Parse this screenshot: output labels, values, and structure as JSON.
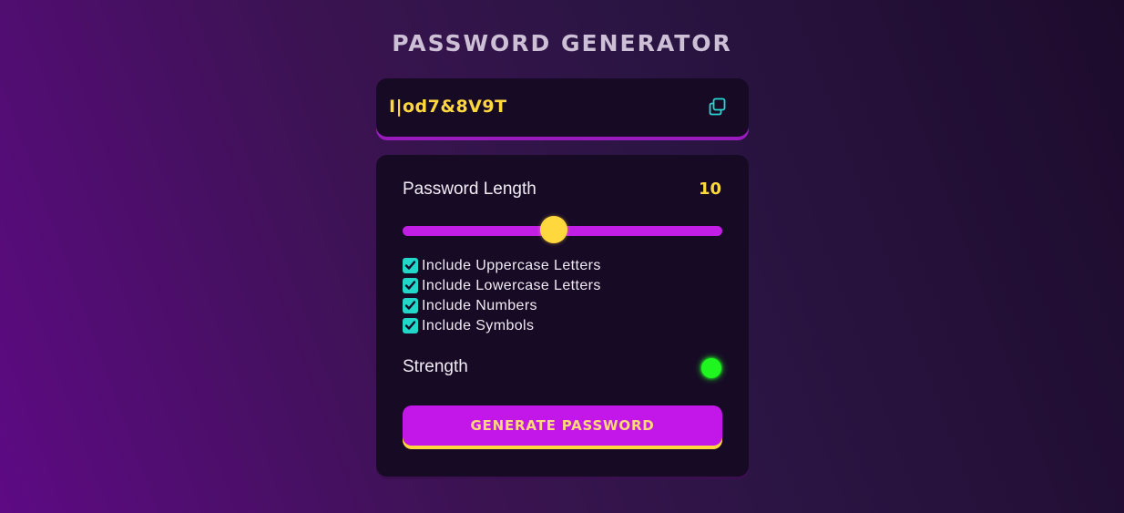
{
  "app": {
    "title": "PASSWORD GENERATOR"
  },
  "result": {
    "password": "I|od7&8V9T",
    "copy_icon": "copy-icon"
  },
  "settings": {
    "length_label": "Password Length",
    "length_value": "10",
    "slider": {
      "value": 10,
      "fraction": 0.47
    },
    "options": [
      {
        "label": "Include Uppercase Letters",
        "checked": true
      },
      {
        "label": "Include Lowercase Letters",
        "checked": true
      },
      {
        "label": "Include Numbers",
        "checked": true
      },
      {
        "label": "Include Symbols",
        "checked": true
      }
    ],
    "strength_label": "Strength",
    "strength_color": "#1ff51f"
  },
  "actions": {
    "generate_label": "GENERATE PASSWORD"
  },
  "colors": {
    "accent_purple": "#c317e9",
    "accent_yellow": "#ffd83d",
    "checkbox_teal": "#22d6c8",
    "panel_bg": "#170a25"
  }
}
